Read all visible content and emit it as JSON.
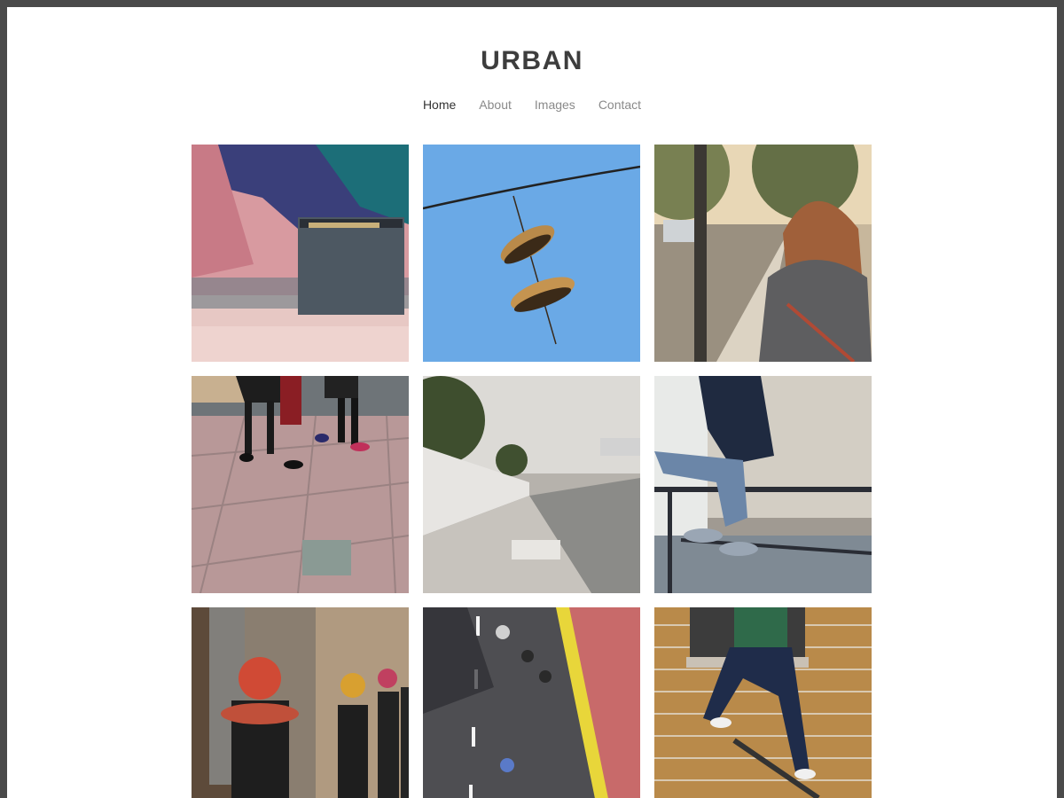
{
  "site": {
    "title": "URBAN"
  },
  "nav": {
    "items": [
      {
        "label": "Home",
        "active": true
      },
      {
        "label": "About",
        "active": false
      },
      {
        "label": "Images",
        "active": false
      },
      {
        "label": "Contact",
        "active": false
      }
    ]
  },
  "gallery": {
    "images": [
      {
        "subject": "trash-can-against-colorful-wall"
      },
      {
        "subject": "shoes-hanging-on-wire"
      },
      {
        "subject": "woman-by-street-pole"
      },
      {
        "subject": "legs-walking-on-pavement"
      },
      {
        "subject": "concrete-riverbank"
      },
      {
        "subject": "person-sitting-on-railing"
      },
      {
        "subject": "bollards-in-street"
      },
      {
        "subject": "skaters-on-road-aerial"
      },
      {
        "subject": "skateboarder-on-brick-wall"
      }
    ]
  }
}
